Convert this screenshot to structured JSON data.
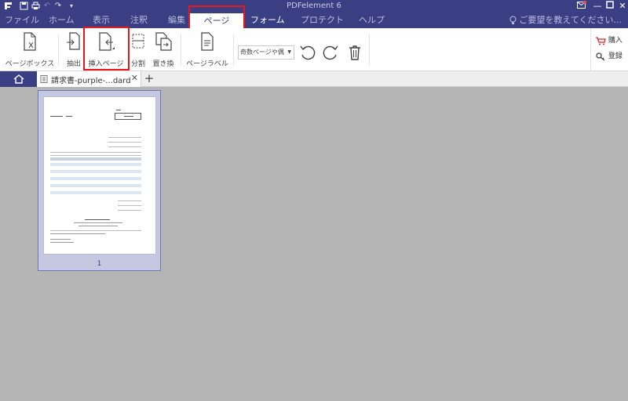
{
  "app_title": "PDFelement 6",
  "menu": {
    "items": [
      "ファイル",
      "ホーム",
      "表示",
      "注釈",
      "編集",
      "ページ",
      "フォーム",
      "プロテクト",
      "ヘルプ"
    ],
    "active": "ページ",
    "hint": "ご要望を教えてください..."
  },
  "toolbar": {
    "page_box": "ページボックス",
    "extract": "抽出",
    "insert_page": "挿入ページ",
    "split": "分割",
    "replace": "置き換",
    "page_label": "ページラベル",
    "page_range_select": "奇数ページや偶",
    "rotate_left_icon": "rotate-left-icon",
    "rotate_right_icon": "rotate-right-icon",
    "delete_icon": "trash-icon",
    "buy": "購入",
    "register": "登録"
  },
  "tabs": {
    "doc_name": "請求書-purple-...dard",
    "add_icon": "plus-icon"
  },
  "thumbnail": {
    "page_number": "1"
  },
  "colors": {
    "primary": "#3a3f84",
    "highlight": "#e8171b",
    "workspace": "#b5b5b5"
  }
}
